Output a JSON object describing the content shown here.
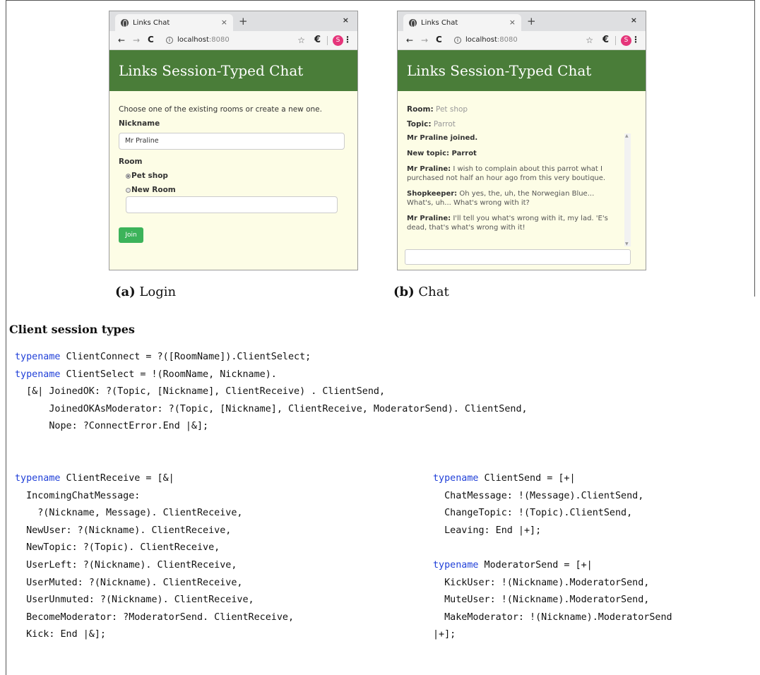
{
  "browser": {
    "tab_title": "Links Chat",
    "tab_close": "×",
    "tab_new": "+",
    "window_close": "×",
    "url_host": "localhost",
    "url_port": ":8080",
    "avatar_letter": "S",
    "app_title": "Links Session-Typed Chat"
  },
  "login": {
    "intro": "Choose one of the existing rooms or create a new one.",
    "nickname_label": "Nickname",
    "nickname_value": "Mr Praline",
    "room_label": "Room",
    "room_options": [
      {
        "label": "Pet shop",
        "selected": true
      },
      {
        "label": "New Room",
        "selected": false
      }
    ],
    "new_room_value": "",
    "join_label": "Join"
  },
  "chat": {
    "room_label": "Room:",
    "room_value": "Pet shop",
    "topic_label": "Topic:",
    "topic_value": "Parrot",
    "messages": [
      {
        "sender": "Mr Praline joined.",
        "text": ""
      },
      {
        "sender": "New topic: Parrot",
        "text": ""
      },
      {
        "sender": "Mr Praline:",
        "text": " I wish to complain about this parrot what I purchased not half an hour ago from this very boutique."
      },
      {
        "sender": "Shopkeeper:",
        "text": " Oh yes, the, uh, the Norwegian Blue... What's, uh... What's wrong with it?"
      },
      {
        "sender": "Mr Praline:",
        "text": " I'll tell you what's wrong with it, my lad. 'E's dead, that's what's wrong with it!"
      }
    ]
  },
  "captions": {
    "a_label": "(a)",
    "a_text": " Login",
    "b_label": "(b)",
    "b_text": " Chat"
  },
  "section_title": "Client session types",
  "code": {
    "keyword": "typename",
    "block1": [
      " ClientConnect = ?([RoomName]).ClientSelect;",
      " ClientSelect = !(RoomName, Nickname).",
      "  [&| JoinedOK: ?(Topic, [Nickname], ClientReceive) . ClientSend,",
      "      JoinedOKAsModerator: ?(Topic, [Nickname], ClientReceive, ModeratorSend). ClientSend,",
      "      Nope: ?ConnectError.End |&];"
    ],
    "block2": [
      " ClientReceive = [&|",
      "  IncomingChatMessage:",
      "    ?(Nickname, Message). ClientReceive,",
      "  NewUser: ?(Nickname). ClientReceive,",
      "  NewTopic: ?(Topic). ClientReceive,",
      "  UserLeft: ?(Nickname). ClientReceive,",
      "  UserMuted: ?(Nickname). ClientReceive,",
      "  UserUnmuted: ?(Nickname). ClientReceive,",
      "  BecomeModerator: ?ModeratorSend. ClientReceive,",
      "  Kick: End |&];"
    ],
    "block3": [
      " ClientSend = [+|",
      "  ChatMessage: !(Message).ClientSend,",
      "  ChangeTopic: !(Topic).ClientSend,",
      "  Leaving: End |+];",
      "",
      " ModeratorSend = [+|",
      "  KickUser: !(Nickname).ModeratorSend,",
      "  MuteUser: !(Nickname).ModeratorSend,",
      "  MakeModerator: !(Nickname).ModeratorSend",
      "|+];"
    ]
  }
}
